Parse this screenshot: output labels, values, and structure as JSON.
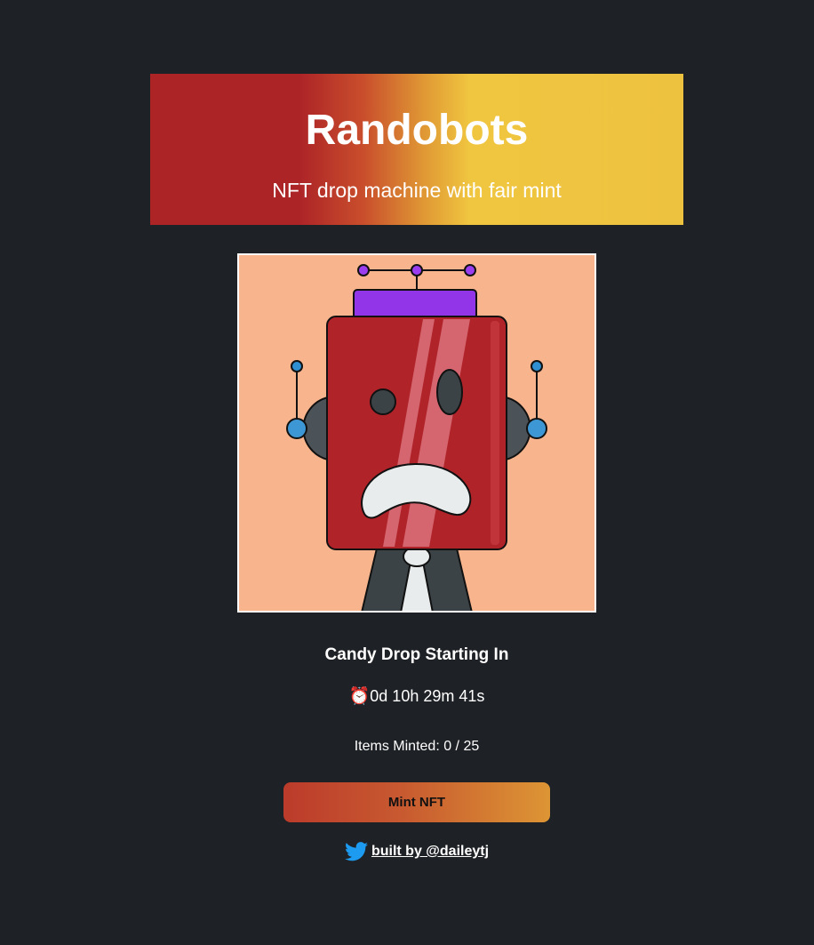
{
  "header": {
    "title": "Randobots",
    "subtitle": "NFT drop machine with fair mint"
  },
  "nft_image": {
    "icon": "robot-nft-artwork"
  },
  "drop": {
    "title": "Candy Drop Starting In",
    "clock_icon": "⏰",
    "countdown": "0d 10h 29m 41s",
    "items_minted": "Items Minted: 0 / 25"
  },
  "mint_button": {
    "label": "Mint NFT"
  },
  "footer": {
    "icon": "twitter-icon",
    "link_text": "built by @daileytj"
  },
  "colors": {
    "background": "#1e2125",
    "gradient_red": "#ad2427",
    "gradient_yellow": "#edc23f",
    "twitter_blue": "#1d9bf0"
  }
}
